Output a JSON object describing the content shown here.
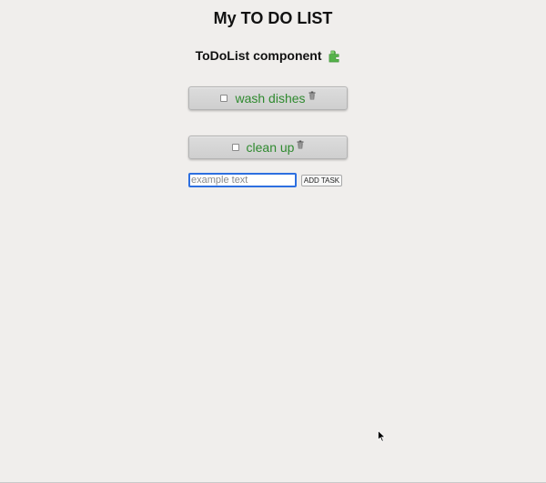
{
  "header": {
    "title": "My TO DO LIST"
  },
  "component": {
    "title": "ToDoList component",
    "icon": "puzzle-icon"
  },
  "tasks": [
    {
      "label": "wash dishes",
      "checked": false,
      "delete_icon": "trash-icon"
    },
    {
      "label": "clean up",
      "checked": false,
      "delete_icon": "trash-icon"
    }
  ],
  "new_task": {
    "placeholder": "example text",
    "value": "",
    "button_label": "ADD TASK"
  },
  "colors": {
    "background": "#f0eeec",
    "task_text": "#2f8a2f",
    "input_focus_border": "#2d6fe0",
    "puzzle": "#55b24a"
  }
}
